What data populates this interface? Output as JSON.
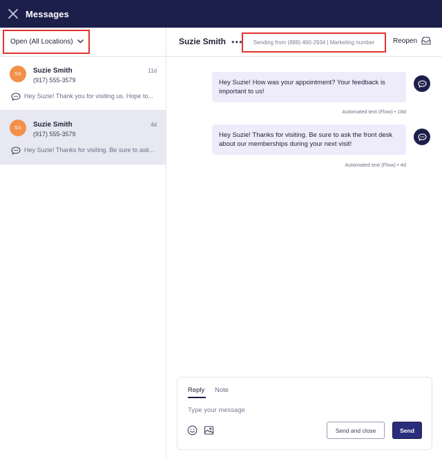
{
  "header": {
    "title": "Messages"
  },
  "sidebar": {
    "filter_label": "Open (All Locations)",
    "conversations": [
      {
        "initials": "SS",
        "name": "Suzie Smith",
        "phone": "(917) 555-3579",
        "time": "11d",
        "preview": "Hey Suzie! Thank you for visiting us. Hope to..."
      },
      {
        "initials": "SS",
        "name": "Suzie Smith",
        "phone": "(917) 555-3579",
        "time": "4d",
        "preview": "Hey Suzie! Thanks for visiting. Be sure to ask..."
      }
    ]
  },
  "chat": {
    "contact_name": "Suzie Smith",
    "more_label": "•••",
    "sending_from": "Sending from (888) 460-2934 | Marketing number",
    "reopen_label": "Reopen",
    "messages": [
      {
        "text": "Hey Suzie! How was your appointment? Your feedback is important to us!",
        "meta": "Automated text (Flow) • 18d"
      },
      {
        "text": "Hey Suzie! Thanks for visiting. Be sure to ask the front desk about our memberships during your next visit!",
        "meta": "Automated text (Flow) • 4d"
      }
    ]
  },
  "composer": {
    "tab_reply": "Reply",
    "tab_note": "Note",
    "placeholder": "Type your message",
    "value": "",
    "send_close_label": "Send and close",
    "send_label": "Send"
  },
  "icons": {
    "close": "close-icon",
    "chevron": "chevron-down-icon",
    "chat_bubble": "chat-bubble-icon",
    "reopen": "inbox-icon",
    "bot": "chat-bubble-icon",
    "emoji": "emoji-icon",
    "image": "image-icon"
  },
  "colors": {
    "topbar": "#1c1f4a",
    "avatar": "#f2904a",
    "outgoing_bubble": "#eeebfb",
    "active_row": "#e7e8f1",
    "highlight": "#e1322b",
    "send_button": "#2a2d7c"
  }
}
